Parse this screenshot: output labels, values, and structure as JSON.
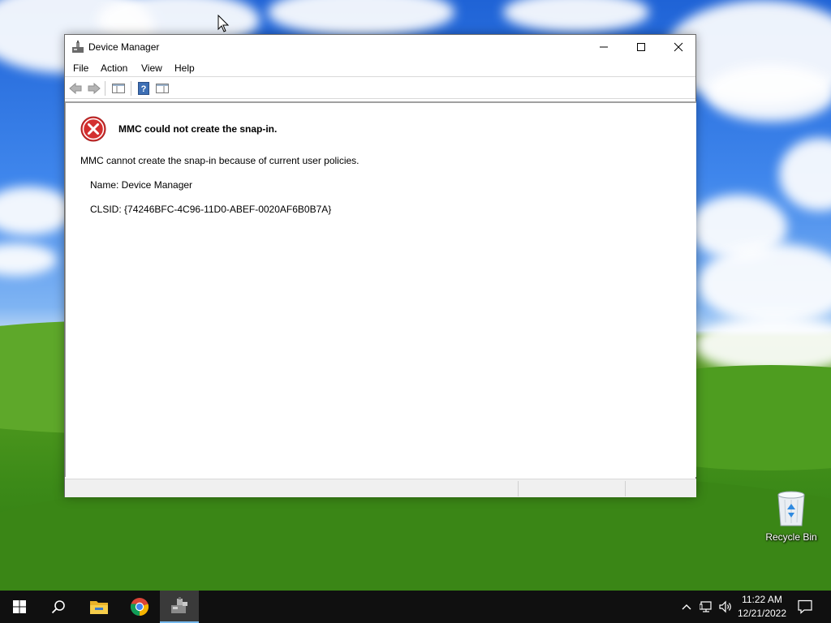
{
  "window": {
    "title": "Device Manager",
    "menu": [
      "File",
      "Action",
      "View",
      "Help"
    ],
    "toolbar_icons": [
      "back-arrow-icon",
      "forward-arrow-icon",
      "show-hide-console-tree-icon",
      "help-icon",
      "show-hide-action-pane-icon"
    ]
  },
  "error": {
    "icon": "error-icon",
    "title": "MMC could not create the snap-in.",
    "description": "MMC cannot create the snap-in because of current user policies.",
    "name_line": "Name: Device Manager",
    "clsid_line": "CLSID: {74246BFC-4C96-11D0-ABEF-0020AF6B0B7A}"
  },
  "desktop": {
    "recycle_bin_label": "Recycle Bin"
  },
  "taskbar": {
    "apps": [
      "windows-start-icon",
      "search-icon",
      "file-explorer-icon",
      "chrome-icon",
      "mmc-icon"
    ],
    "active_app": "mmc-icon",
    "time": "11:22 AM",
    "date": "12/21/2022"
  },
  "colors": {
    "error_red": "#d32f2f",
    "taskbar_bg": "#101010",
    "active_underline": "#76b9ed"
  }
}
